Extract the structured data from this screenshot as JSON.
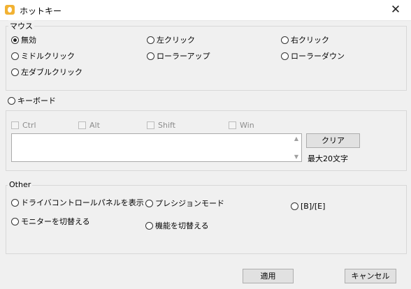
{
  "window": {
    "title": "ホットキー",
    "close_glyph": "✕"
  },
  "mouse_group": {
    "title": "マウス",
    "options": [
      {
        "label": "無効",
        "checked": true
      },
      {
        "label": "左クリック",
        "checked": false
      },
      {
        "label": "右クリック",
        "checked": false
      },
      {
        "label": "ミドルクリック",
        "checked": false
      },
      {
        "label": "ローラーアップ",
        "checked": false
      },
      {
        "label": "ローラーダウン",
        "checked": false
      },
      {
        "label": "左ダブルクリック",
        "checked": false
      }
    ]
  },
  "keyboard": {
    "radio_label": "キーボード",
    "modifiers": [
      "Ctrl",
      "Alt",
      "Shift",
      "Win"
    ],
    "clear_label": "クリア",
    "max_length_note": "最大20文字",
    "text_value": "",
    "scroll_up_glyph": "▲",
    "scroll_down_glyph": "▼"
  },
  "other_group": {
    "title": "Other",
    "options": [
      {
        "label": "ドライバコントロールパネルを表示"
      },
      {
        "label": "プレシジョンモード"
      },
      {
        "label": "[B]/[E]"
      },
      {
        "label": "モニターを切替える"
      },
      {
        "label": "機能を切替える"
      }
    ]
  },
  "footer": {
    "apply_label": "適用",
    "cancel_label": "キャンセル"
  }
}
